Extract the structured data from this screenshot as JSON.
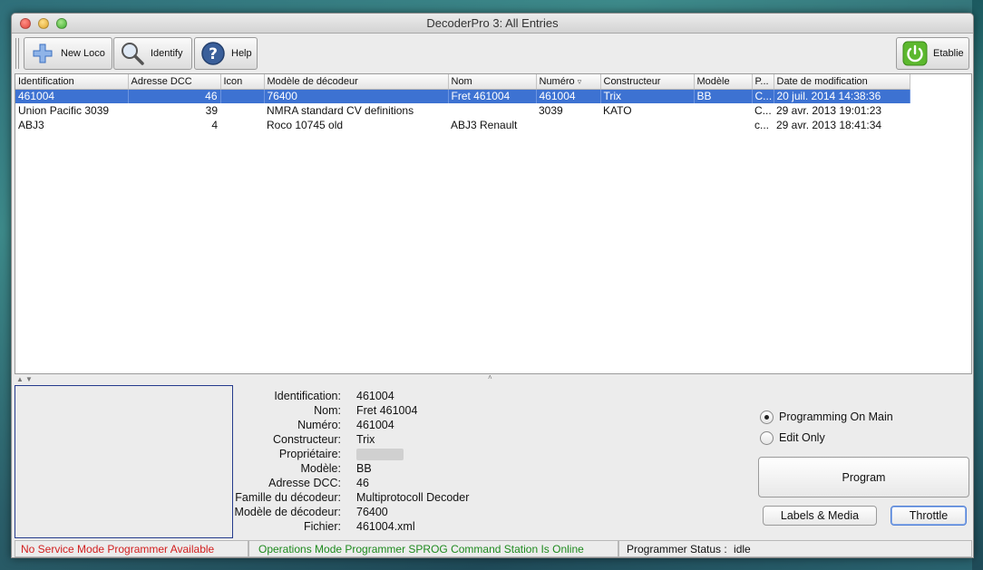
{
  "window": {
    "title": "DecoderPro 3: All Entries"
  },
  "toolbar": {
    "new_loco": "New Loco",
    "identify": "Identify",
    "help": "Help",
    "power": "Etablie",
    "power_color": "#5cb82e"
  },
  "table": {
    "columns": [
      "Identification",
      "Adresse DCC",
      "Icon",
      "Modèle de décodeur",
      "Nom",
      "Numéro",
      "Constructeur",
      "Modèle",
      "P...",
      "Date de modification"
    ],
    "sort_indicator": "▿",
    "rows": [
      [
        "461004",
        "46",
        "",
        "76400",
        "Fret 461004",
        "461004",
        "Trix",
        "BB",
        "C...",
        "20 juil. 2014 14:38:36"
      ],
      [
        "Union Pacific 3039",
        "39",
        "",
        "NMRA standard CV definitions",
        "",
        "3039",
        "KATO",
        "",
        "C...",
        "29 avr. 2013 19:01:23"
      ],
      [
        "ABJ3",
        "4",
        "",
        "Roco 10745 old",
        "ABJ3 Renault",
        "",
        "",
        "",
        "c...",
        "29 avr. 2013 18:41:34"
      ]
    ],
    "selected_row": 0,
    "selection_color": "#3d72d2"
  },
  "details": [
    {
      "label": "Identification:",
      "value": "461004"
    },
    {
      "label": "Nom:",
      "value": "Fret 461004"
    },
    {
      "label": "Numéro:",
      "value": "461004"
    },
    {
      "label": "Constructeur:",
      "value": "Trix"
    },
    {
      "label": "Propriétaire:",
      "value": ""
    },
    {
      "label": "Modèle:",
      "value": "BB"
    },
    {
      "label": "Adresse DCC:",
      "value": "46"
    },
    {
      "label": "Famille du décodeur:",
      "value": "Multiprotocoll Decoder"
    },
    {
      "label": "Modèle de décodeur:",
      "value": "76400"
    },
    {
      "label": "Fichier:",
      "value": "461004.xml"
    }
  ],
  "mode": {
    "programming_on_main": "Programming On Main",
    "edit_only": "Edit Only",
    "selected": "programming_on_main"
  },
  "buttons": {
    "program": "Program",
    "labels_media": "Labels & Media",
    "throttle": "Throttle"
  },
  "status": {
    "service_mode": "No Service Mode Programmer Available",
    "service_mode_color": "#d22020",
    "ops_mode": "Operations Mode Programmer SPROG Command Station Is Online",
    "ops_mode_color": "#1e8a1e",
    "programmer_status_label": "Programmer Status :",
    "programmer_status_value": "idle"
  }
}
